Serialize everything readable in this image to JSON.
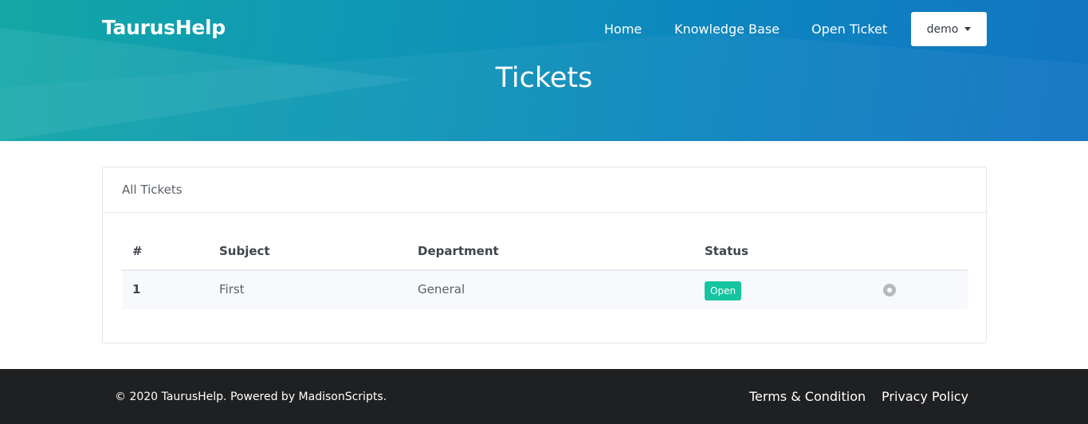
{
  "header": {
    "brand": "TaurusHelp",
    "nav": {
      "home": "Home",
      "knowledge_base": "Knowledge Base",
      "open_ticket": "Open Ticket"
    },
    "user_menu": "demo",
    "page_title": "Tickets"
  },
  "tickets_card": {
    "title": "All Tickets",
    "columns": {
      "number": "#",
      "subject": "Subject",
      "department": "Department",
      "status": "Status"
    },
    "rows": [
      {
        "number": "1",
        "subject": "First",
        "department": "General",
        "status": "Open"
      }
    ]
  },
  "footer": {
    "copyright": "© 2020 TaurusHelp. Powered by MadisonScripts.",
    "terms": "Terms & Condition",
    "privacy": "Privacy Policy"
  },
  "colors": {
    "accent": "#0d86bf",
    "status_open": "#14c5a0",
    "footer_bg": "#1f2022"
  },
  "icons": {
    "row_action": "view-icon",
    "user_menu_caret": "caret-down-icon"
  }
}
